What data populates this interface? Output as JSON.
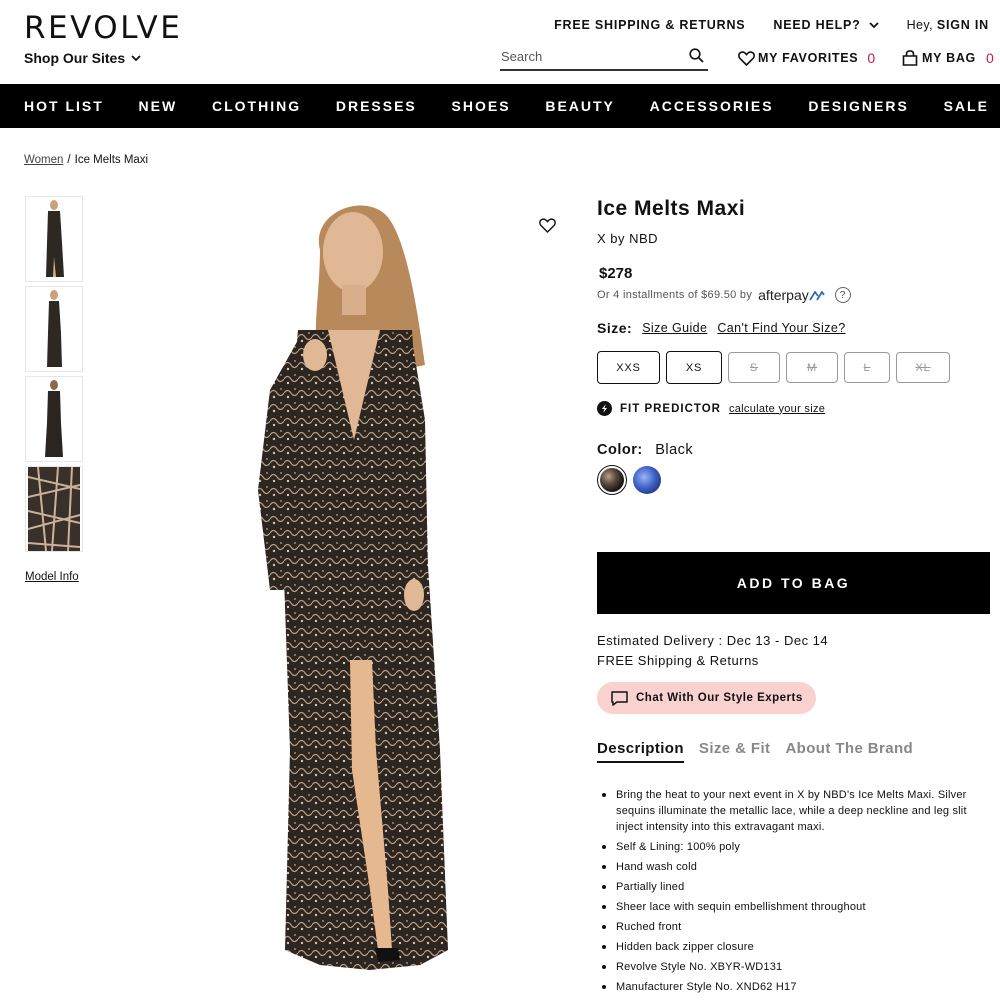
{
  "header": {
    "logo": "REVOLVE",
    "shop_sites": "Shop Our Sites",
    "free_shipping": "FREE SHIPPING & RETURNS",
    "need_help": "NEED HELP?",
    "greeting": "Hey,",
    "sign_in": "SIGN IN",
    "search_placeholder": "Search",
    "favorites_label": "MY FAVORITES",
    "favorites_count": "0",
    "bag_label": "MY BAG",
    "bag_count": "0"
  },
  "nav": {
    "items": [
      "HOT LIST",
      "NEW",
      "CLOTHING",
      "DRESSES",
      "SHOES",
      "BEAUTY",
      "ACCESSORIES",
      "DESIGNERS",
      "SALE"
    ]
  },
  "breadcrumb": {
    "parent": "Women",
    "separator": "/",
    "current": "Ice Melts Maxi"
  },
  "gallery": {
    "model_info": "Model Info"
  },
  "product": {
    "title": "Ice Melts Maxi",
    "brand": "X by NBD",
    "price": "$278",
    "installments": "Or 4 installments of $69.50 by",
    "afterpay_logo": "afterpay",
    "afterpay_help": "?",
    "size_label": "Size:",
    "size_guide": "Size Guide",
    "cant_find_size": "Can't Find Your Size?",
    "sizes": [
      {
        "label": "XXS",
        "available": true
      },
      {
        "label": "XS",
        "available": true
      },
      {
        "label": "S",
        "available": false
      },
      {
        "label": "M",
        "available": false
      },
      {
        "label": "L",
        "available": false
      },
      {
        "label": "XL",
        "available": false
      }
    ],
    "fit_predictor": "FIT PREDICTOR",
    "calculate_size": "calculate your size",
    "color_label": "Color:",
    "color_value": "Black",
    "add_to_bag": "ADD TO BAG",
    "delivery": "Estimated Delivery : Dec 13 - Dec 14",
    "free_shipping": "FREE Shipping & Returns",
    "chat": "Chat With Our Style Experts"
  },
  "tabs": [
    "Description",
    "Size & Fit",
    "About The Brand"
  ],
  "description": [
    "Bring the heat to your next event in X by NBD's Ice Melts Maxi. Silver sequins illuminate the metallic lace, while a deep neckline and leg slit inject intensity into this extravagant maxi.",
    "Self & Lining: 100% poly",
    "Hand wash cold",
    "Partially lined",
    "Sheer lace with sequin embellishment throughout",
    "Ruched front",
    "Hidden back zipper closure",
    "Revolve Style No. XBYR-WD131",
    "Manufacturer Style No. XND62 H17"
  ],
  "colors": {
    "accent_count": "#c2185b",
    "nav_bg": "#000000",
    "chat_bg": "#f9d2cf"
  }
}
